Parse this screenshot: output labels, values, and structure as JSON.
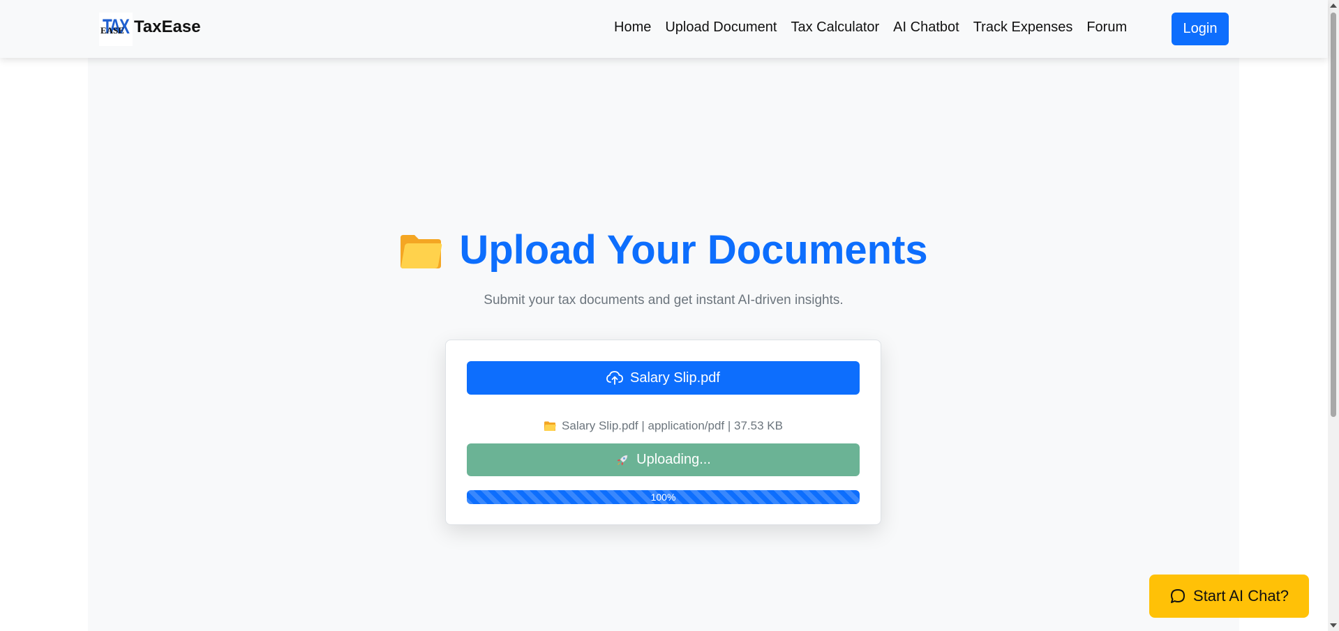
{
  "brand": {
    "logo_top": "TAX",
    "logo_bottom": "EASE",
    "name": "TaxEase"
  },
  "nav": {
    "links": [
      "Home",
      "Upload Document",
      "Tax Calculator",
      "AI Chatbot",
      "Track Expenses",
      "Forum"
    ],
    "login_label": "Login"
  },
  "hero": {
    "title": "Upload Your Documents",
    "subtitle": "Submit your tax documents and get instant AI-driven insights."
  },
  "upload_card": {
    "file_button_label": "Salary Slip.pdf",
    "file_info": "Salary Slip.pdf | application/pdf | 37.53 KB",
    "upload_button_label": "Uploading...",
    "progress_percent": 100,
    "progress_label": "100%"
  },
  "chat": {
    "label": "Start AI Chat?"
  },
  "colors": {
    "primary": "#0d6efd",
    "upload_green": "#6bb395",
    "chat_yellow": "#ffc107"
  }
}
